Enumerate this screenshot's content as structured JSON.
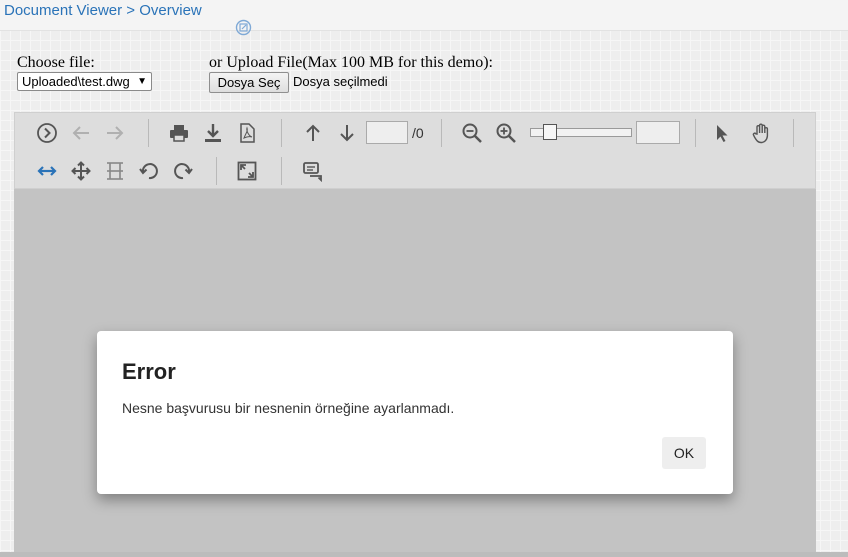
{
  "breadcrumb": {
    "root": "Document Viewer",
    "separator": " > ",
    "current": "Overview",
    "icon": "overview-link-icon"
  },
  "file_chooser": {
    "label": "Choose file:",
    "selected": "Uploaded\\test.dwg",
    "arrow": "▼"
  },
  "upload": {
    "label": "or Upload File(Max 100 MB for this demo):",
    "button": "Dosya Seç",
    "status": "Dosya seçilmedi"
  },
  "toolbar": {
    "page_total": "/0",
    "icons": [
      "next-document-icon",
      "back-arrow-icon",
      "forward-arrow-icon",
      "print-icon",
      "download-icon",
      "pdf-icon",
      "page-up-icon",
      "page-down-icon",
      "zoom-out-icon",
      "zoom-in-icon",
      "pointer-icon",
      "pan-hand-icon",
      "fit-width-icon",
      "fit-page-icon",
      "fit-height-icon",
      "rotate-left-icon",
      "rotate-right-icon",
      "fullscreen-icon",
      "comments-icon"
    ]
  },
  "dialog": {
    "title": "Error",
    "message": "Nesne başvurusu bir nesnenin örneğine ayarlanmadı.",
    "ok_label": "OK"
  },
  "colors": {
    "link": "#2a73b8",
    "toolbar_bg": "#dddddd",
    "viewer_bg": "#c3c3c3",
    "icon": "#555555",
    "icon_disabled": "#b0b0b0",
    "icon_active": "#2a73b8"
  }
}
